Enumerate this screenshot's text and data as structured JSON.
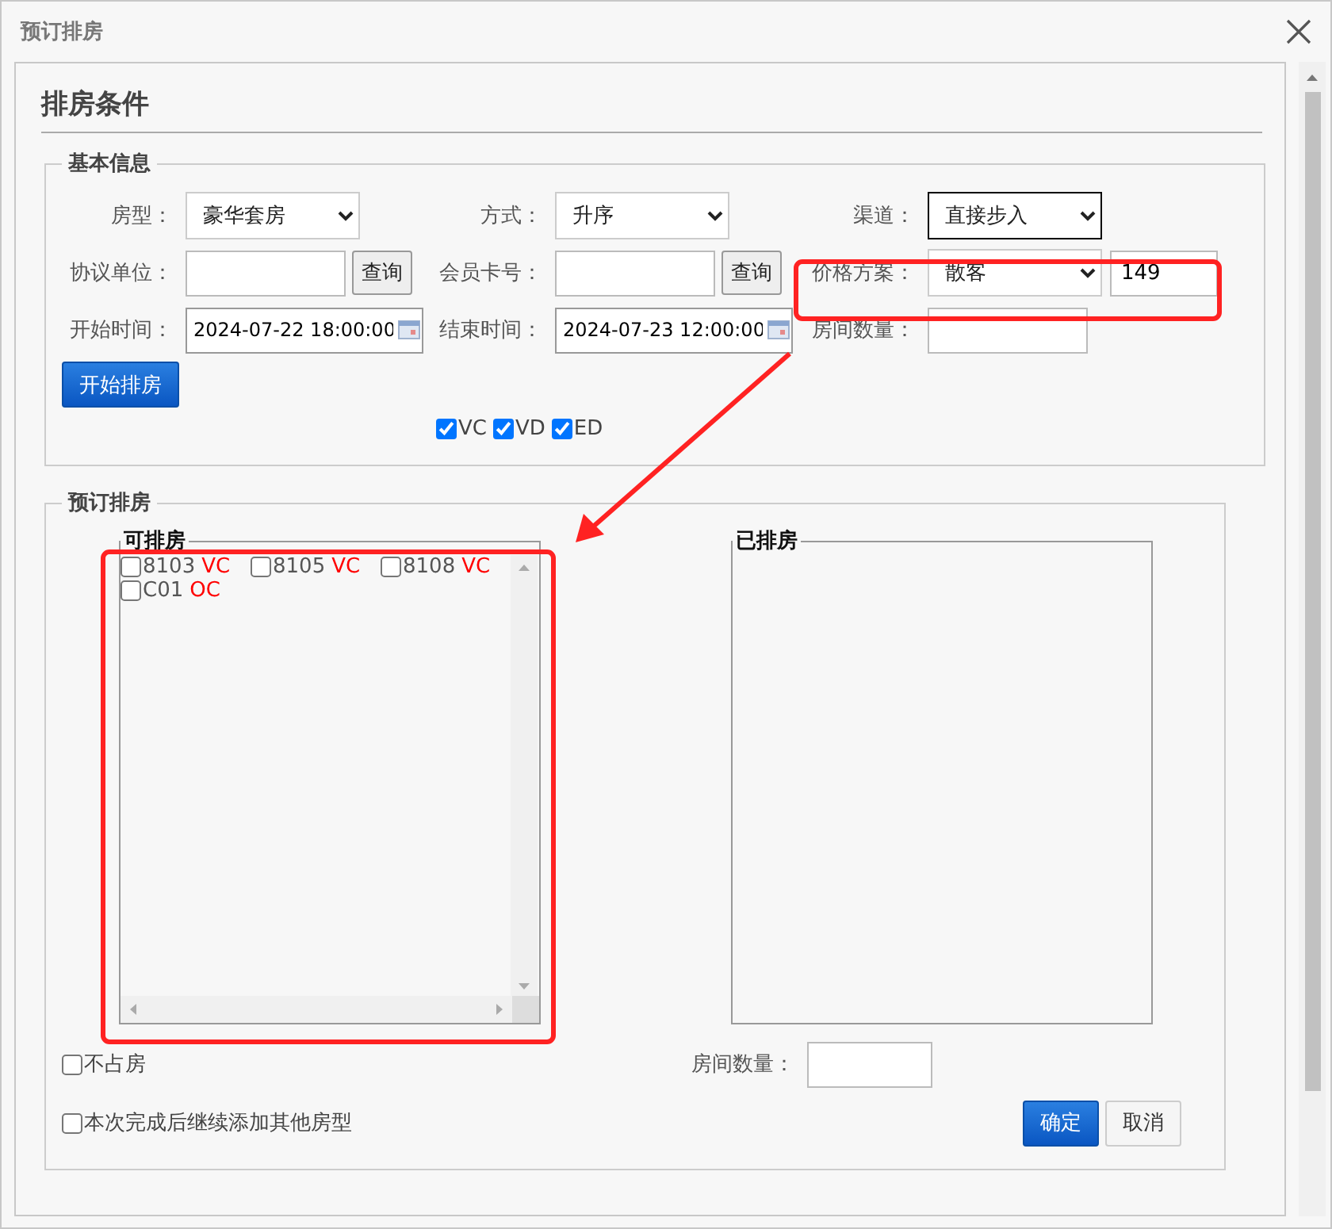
{
  "window": {
    "title": "预订排房"
  },
  "section_title": "排房条件",
  "basic_info": {
    "legend": "基本信息",
    "rows": [
      [
        {
          "label": "房型：",
          "control": {
            "kind": "select",
            "value": "豪华套房",
            "focused": false
          }
        },
        {
          "label": "方式：",
          "control": {
            "kind": "select",
            "value": "升序",
            "focused": false
          }
        },
        {
          "label": "渠道：",
          "control": {
            "kind": "select",
            "value": "直接步入",
            "focused": true
          }
        }
      ],
      [
        {
          "label": "协议单位：",
          "control": {
            "kind": "input"
          },
          "button": "查询"
        },
        {
          "label": "会员卡号：",
          "control": {
            "kind": "input"
          },
          "button": "查询"
        },
        {
          "label": "价格方案：",
          "control": {
            "kind": "select",
            "value": "散客",
            "focused": false
          },
          "extra": "149"
        }
      ],
      [
        {
          "label": "开始时间：",
          "control": {
            "kind": "date",
            "value": "2024-07-22 18:00:00"
          }
        },
        {
          "label": "结束时间：",
          "control": {
            "kind": "date",
            "value": "2024-07-23 12:00:00"
          }
        },
        {
          "label": "房间数量：",
          "control": {
            "kind": "input"
          }
        }
      ]
    ],
    "start_button": "开始排房",
    "filters": [
      {
        "label": "VC",
        "checked": true
      },
      {
        "label": "VD",
        "checked": true
      },
      {
        "label": "ED",
        "checked": true
      }
    ]
  },
  "booking": {
    "legend": "预订排房",
    "available": {
      "legend": "可排房",
      "rooms": [
        {
          "number": "8103",
          "status": "VC",
          "checked": false
        },
        {
          "number": "8105",
          "status": "VC",
          "checked": false
        },
        {
          "number": "8108",
          "status": "VC",
          "checked": false
        },
        {
          "number": "C01",
          "status": "OC",
          "checked": false
        }
      ]
    },
    "assigned": {
      "legend": "已排房"
    },
    "options": [
      {
        "label": "不占房",
        "checked": false
      },
      {
        "label": "本次完成后继续添加其他房型",
        "checked": false
      }
    ],
    "room_count": {
      "label": "房间数量："
    },
    "buttons": [
      {
        "label": "确定",
        "kind": "primary"
      },
      {
        "label": "取消",
        "kind": "default"
      }
    ]
  }
}
